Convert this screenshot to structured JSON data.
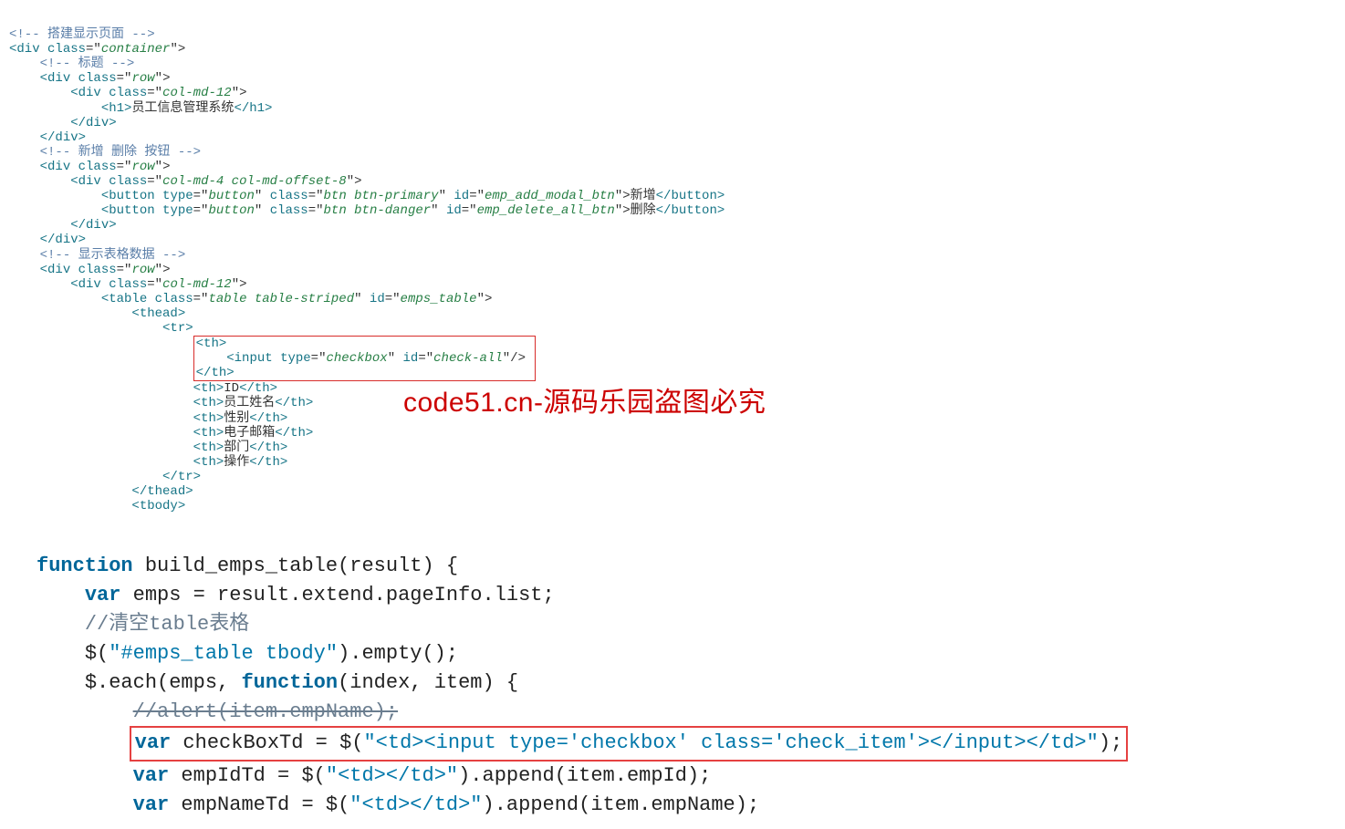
{
  "watermark": "code51.cn-源码乐园盗图必究",
  "block1": {
    "c1": "<!-- 搭建显示页面 -->",
    "l2a": "<div ",
    "l2b": "class",
    "l2c": "=\"",
    "l2d": "container",
    "l2e": "\">",
    "c2": "<!-- 标题 -->",
    "l3a": "<div ",
    "l3b": "class",
    "l3c": "=\"",
    "l3d": "row",
    "l3e": "\">",
    "l4a": "<div ",
    "l4b": "class",
    "l4c": "=\"",
    "l4d": "col-md-12",
    "l4e": "\">",
    "l5a": "<h1>",
    "l5b": "员工信息管理系统",
    "l5c": "</h1>",
    "l6": "</div>",
    "l7": "</div>",
    "c3": "<!-- 新增 删除 按钮 -->",
    "l8a": "<div ",
    "l8b": "class",
    "l8c": "=\"",
    "l8d": "row",
    "l8e": "\">",
    "l9a": "<div ",
    "l9b": "class",
    "l9c": "=\"",
    "l9d": "col-md-4 col-md-offset-8",
    "l9e": "\">",
    "l10a": "<button ",
    "l10b": "type",
    "l10c": "=\"",
    "l10d": "button",
    "l10e": "\" ",
    "l10f": "class",
    "l10g": "=\"",
    "l10h": "btn btn-primary",
    "l10i": "\" ",
    "l10j": "id",
    "l10k": "=\"",
    "l10l": "emp_add_modal_btn",
    "l10m": "\">",
    "l10n": "新增",
    "l10o": "</button>",
    "l11a": "<button ",
    "l11b": "type",
    "l11c": "=\"",
    "l11d": "button",
    "l11e": "\" ",
    "l11f": "class",
    "l11g": "=\"",
    "l11h": "btn btn-danger",
    "l11i": "\" ",
    "l11j": "id",
    "l11k": "=\"",
    "l11l": "emp_delete_all_btn",
    "l11m": "\">",
    "l11n": "删除",
    "l11o": "</button>",
    "l12": "</div>",
    "l13": "</div>",
    "c4": "<!-- 显示表格数据 -->",
    "l14a": "<div ",
    "l14b": "class",
    "l14c": "=\"",
    "l14d": "row",
    "l14e": "\">",
    "l15a": "<div ",
    "l15b": "class",
    "l15c": "=\"",
    "l15d": "col-md-12",
    "l15e": "\">",
    "l16a": "<table ",
    "l16b": "class",
    "l16c": "=\"",
    "l16d": "table table-striped",
    "l16e": "\" ",
    "l16f": "id",
    "l16g": "=\"",
    "l16h": "emps_table",
    "l16i": "\">",
    "l17": "<thead>",
    "l18": "<tr>",
    "box_a": "<th>",
    "box_b1": "<input ",
    "box_b2": "type",
    "box_b3": "=\"",
    "box_b4": "checkbox",
    "box_b5": "\" ",
    "box_b6": "id",
    "box_b7": "=\"",
    "box_b8": "check-all",
    "box_b9": "\"/>",
    "box_c": "</th>",
    "l22a": "<th>",
    "l22b": "ID",
    "l22c": "</th>",
    "l23a": "<th>",
    "l23b": "员工姓名",
    "l23c": "</th>",
    "l24a": "<th>",
    "l24b": "性别",
    "l24c": "</th>",
    "l25a": "<th>",
    "l25b": "电子邮箱",
    "l25c": "</th>",
    "l26a": "<th>",
    "l26b": "部门",
    "l26c": "</th>",
    "l27a": "<th>",
    "l27b": "操作",
    "l27c": "</th>",
    "l28": "</tr>",
    "l29": "</thead>",
    "l30": "<tbody>"
  },
  "block2": {
    "l1a": "function",
    "l1b": " build_emps_table(result) {",
    "l2a": "var",
    "l2b": " emps = result.extend.pageInfo.list;",
    "l3": "//清空table表格",
    "l4a": "$(",
    "l4b": "\"#emps_table tbody\"",
    "l4c": ").empty();",
    "l5a": "$.each(emps, ",
    "l5b": "function",
    "l5c": "(index, item) {",
    "l6": "//alert(item.empName);",
    "l7a": "var",
    "l7b": " checkBoxTd = $(",
    "l7c": "\"<td><input type='checkbox' class='check_item'></input></td>\"",
    "l7d": ");",
    "l8a": "var",
    "l8b": " empIdTd = $(",
    "l8c": "\"<td></td>\"",
    "l8d": ").append(item.empId);",
    "l9a": "var",
    "l9b": " empNameTd = $(",
    "l9c": "\"<td></td>\"",
    "l9d": ").append(item.empName);"
  }
}
